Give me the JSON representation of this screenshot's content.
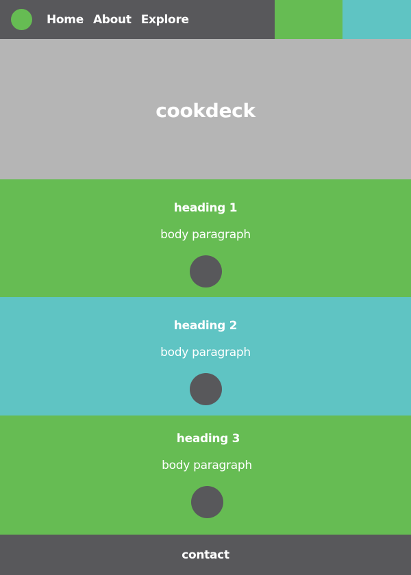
{
  "colors": {
    "dark": "#58585b",
    "green": "#66bc53",
    "teal": "#5fc4c3",
    "gray": "#b5b5b5",
    "text": "#ffffff"
  },
  "nav": {
    "links": [
      "Home",
      "About",
      "Explore"
    ]
  },
  "hero": {
    "title": "cookdeck"
  },
  "sections": [
    {
      "heading": "heading 1",
      "body": "body paragraph"
    },
    {
      "heading": "heading 2",
      "body": "body paragraph"
    },
    {
      "heading": "heading 3",
      "body": "body paragraph"
    }
  ],
  "footer": {
    "label": "contact"
  }
}
